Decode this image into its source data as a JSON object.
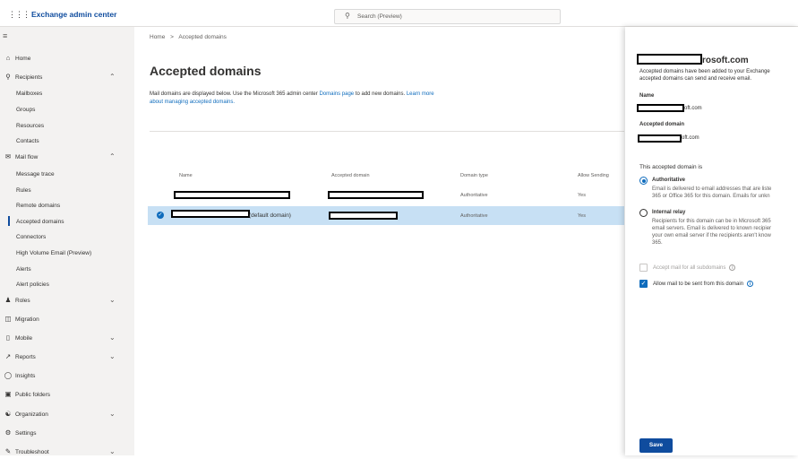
{
  "header": {
    "app_title": "Exchange admin center",
    "search_placeholder": "Search (Preview)"
  },
  "sidebar": {
    "items": [
      {
        "label": "Home",
        "icon": "home-icon"
      },
      {
        "label": "Recipients",
        "icon": "person-icon",
        "expanded": true
      },
      {
        "label": "Mailboxes",
        "sub": true
      },
      {
        "label": "Groups",
        "sub": true
      },
      {
        "label": "Resources",
        "sub": true
      },
      {
        "label": "Contacts",
        "sub": true
      },
      {
        "label": "Mail flow",
        "icon": "mail-icon",
        "expanded": true
      },
      {
        "label": "Message trace",
        "sub": true
      },
      {
        "label": "Rules",
        "sub": true
      },
      {
        "label": "Remote domains",
        "sub": true
      },
      {
        "label": "Accepted domains",
        "sub": true,
        "selected": true
      },
      {
        "label": "Connectors",
        "sub": true
      },
      {
        "label": "High Volume Email (Preview)",
        "sub": true
      },
      {
        "label": "Alerts",
        "sub": true
      },
      {
        "label": "Alert policies",
        "sub": true
      },
      {
        "label": "Roles",
        "icon": "roles-icon"
      },
      {
        "label": "Migration",
        "icon": "migration-icon"
      },
      {
        "label": "Mobile",
        "icon": "mobile-icon"
      },
      {
        "label": "Reports",
        "icon": "reports-icon"
      },
      {
        "label": "Insights",
        "icon": "insights-icon"
      },
      {
        "label": "Public folders",
        "icon": "folder-icon"
      },
      {
        "label": "Organization",
        "icon": "organization-icon"
      },
      {
        "label": "Settings",
        "icon": "gear-icon"
      },
      {
        "label": "Troubleshoot",
        "icon": "troubleshoot-icon"
      }
    ]
  },
  "main": {
    "breadcrumb_home": "Home",
    "breadcrumb_sep": ">",
    "breadcrumb_current": "Accepted domains",
    "title": "Accepted domains",
    "desc_part1": "Mail domains are displayed below. Use the Microsoft 365 admin center ",
    "desc_link1": "Domains page",
    "desc_part2": " to add new domains. ",
    "desc_link2": "Learn more about managing accepted domains.",
    "columns": [
      "Name",
      "Accepted domain",
      "Domain type",
      "Allow Sending"
    ],
    "rows": [
      {
        "name_suffix": "",
        "domain_type": "Authoritative",
        "allow_sending": "Yes",
        "selected": false
      },
      {
        "name_suffix": "(default domain)",
        "domain_type": "Authoritative",
        "allow_sending": "Yes",
        "selected": true
      }
    ]
  },
  "panel": {
    "title_suffix": "rosoft.com",
    "desc_line1": "Accepted domains have been added to your Exchange",
    "desc_line2": "accepted domains can send and receive email.",
    "name_label": "Name",
    "name_value_suffix": "oft.com",
    "accepted_label": "Accepted domain",
    "accepted_value_suffix": "oft.com",
    "section_title": "This accepted domain is",
    "authoritative_title": "Authoritative",
    "authoritative_desc1": "Email is delivered to email addresses that are liste",
    "authoritative_desc2": "365 or Office 365 for this domain. Emails for unkn",
    "relay_title": "Internal relay",
    "relay_desc1": "Recipients for this domain can be in Microsoft 365",
    "relay_desc2": "email servers. Email is delivered to known recipier",
    "relay_desc3": "your own email server if the recipients aren't know",
    "relay_desc4": "365.",
    "subdomains_label": "Accept mail for all subdomains",
    "allow_send_label": "Allow mail to be sent from this domain",
    "save_label": "Save"
  },
  "colors": {
    "brand": "#0f4c9e",
    "link": "#0f6cbd",
    "selected_row": "#c7e0f4",
    "sidebar_bg": "#f3f2f1"
  }
}
